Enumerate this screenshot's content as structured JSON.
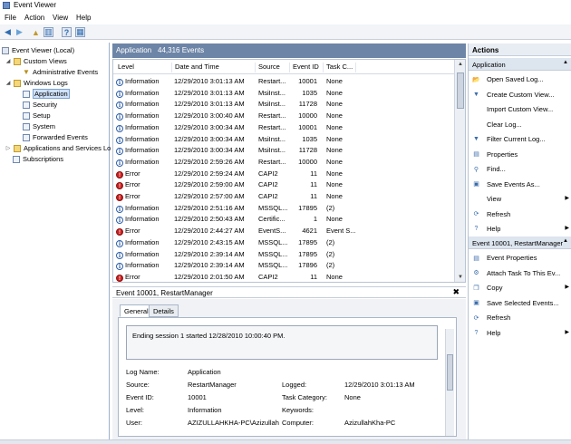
{
  "window": {
    "title": "Event Viewer"
  },
  "menu": [
    "File",
    "Action",
    "View",
    "Help"
  ],
  "toolbar": {
    "back_icon": "back-arrow-icon",
    "forward_icon": "forward-arrow-icon",
    "up_icon": "folder-up-icon",
    "tree_icon": "show-tree-icon",
    "help_icon": "help-icon",
    "pane_icon": "show-pane-icon"
  },
  "tree": {
    "root": "Event Viewer (Local)",
    "custom_views": "Custom Views",
    "admin_events": "Administrative Events",
    "windows_logs": "Windows Logs",
    "application": "Application",
    "security": "Security",
    "setup": "Setup",
    "system": "System",
    "forwarded": "Forwarded Events",
    "apps_services": "Applications and Services Lo",
    "subscriptions": "Subscriptions"
  },
  "center": {
    "log_name": "Application",
    "event_count": "44,316 Events"
  },
  "columns": [
    "Level",
    "Date and Time",
    "Source",
    "Event ID",
    "Task C..."
  ],
  "events": [
    {
      "level": "Information",
      "type": "info",
      "date": "12/29/2010 3:01:13 AM",
      "source": "Restart...",
      "id": "10001",
      "task": "None"
    },
    {
      "level": "Information",
      "type": "info",
      "date": "12/29/2010 3:01:13 AM",
      "source": "MsiInst...",
      "id": "1035",
      "task": "None"
    },
    {
      "level": "Information",
      "type": "info",
      "date": "12/29/2010 3:01:13 AM",
      "source": "MsiInst...",
      "id": "11728",
      "task": "None"
    },
    {
      "level": "Information",
      "type": "info",
      "date": "12/29/2010 3:00:40 AM",
      "source": "Restart...",
      "id": "10000",
      "task": "None"
    },
    {
      "level": "Information",
      "type": "info",
      "date": "12/29/2010 3:00:34 AM",
      "source": "Restart...",
      "id": "10001",
      "task": "None"
    },
    {
      "level": "Information",
      "type": "info",
      "date": "12/29/2010 3:00:34 AM",
      "source": "MsiInst...",
      "id": "1035",
      "task": "None"
    },
    {
      "level": "Information",
      "type": "info",
      "date": "12/29/2010 3:00:34 AM",
      "source": "MsiInst...",
      "id": "11728",
      "task": "None"
    },
    {
      "level": "Information",
      "type": "info",
      "date": "12/29/2010 2:59:26 AM",
      "source": "Restart...",
      "id": "10000",
      "task": "None"
    },
    {
      "level": "Error",
      "type": "err",
      "date": "12/29/2010 2:59:24 AM",
      "source": "CAPI2",
      "id": "11",
      "task": "None"
    },
    {
      "level": "Error",
      "type": "err",
      "date": "12/29/2010 2:59:00 AM",
      "source": "CAPI2",
      "id": "11",
      "task": "None"
    },
    {
      "level": "Error",
      "type": "err",
      "date": "12/29/2010 2:57:00 AM",
      "source": "CAPI2",
      "id": "11",
      "task": "None"
    },
    {
      "level": "Information",
      "type": "info",
      "date": "12/29/2010 2:51:16 AM",
      "source": "MSSQL...",
      "id": "17895",
      "task": "(2)"
    },
    {
      "level": "Information",
      "type": "info",
      "date": "12/29/2010 2:50:43 AM",
      "source": "Certific...",
      "id": "1",
      "task": "None"
    },
    {
      "level": "Error",
      "type": "err",
      "date": "12/29/2010 2:44:27 AM",
      "source": "EventS...",
      "id": "4621",
      "task": "Event S..."
    },
    {
      "level": "Information",
      "type": "info",
      "date": "12/29/2010 2:43:15 AM",
      "source": "MSSQL...",
      "id": "17895",
      "task": "(2)"
    },
    {
      "level": "Information",
      "type": "info",
      "date": "12/29/2010 2:39:14 AM",
      "source": "MSSQL...",
      "id": "17895",
      "task": "(2)"
    },
    {
      "level": "Information",
      "type": "info",
      "date": "12/29/2010 2:39:14 AM",
      "source": "MSSQL...",
      "id": "17896",
      "task": "(2)"
    },
    {
      "level": "Error",
      "type": "err",
      "date": "12/29/2010 2:01:50 AM",
      "source": "CAPI2",
      "id": "11",
      "task": "None"
    }
  ],
  "detail": {
    "title": "Event 10001, RestartManager",
    "close": "✖",
    "tabs": [
      "General",
      "Details"
    ],
    "message": "Ending session 1 started 12/28/2010 10:00:40 PM.",
    "fields": {
      "log_name_label": "Log Name:",
      "log_name": "Application",
      "source_label": "Source:",
      "source": "RestartManager",
      "logged_label": "Logged:",
      "logged": "12/29/2010 3:01:13 AM",
      "event_id_label": "Event ID:",
      "event_id": "10001",
      "task_label": "Task Category:",
      "task": "None",
      "level_label": "Level:",
      "level": "Information",
      "keywords_label": "Keywords:",
      "keywords": "",
      "user_label": "User:",
      "user": "AZIZULLAHKHA-PC\\Azizullah",
      "computer_label": "Computer:",
      "computer": "AzizullahKha-PC"
    }
  },
  "actions": {
    "title": "Actions",
    "section1": "Application",
    "items1": [
      {
        "label": "Open Saved Log...",
        "icon": "open-log-icon",
        "glyph": "📂",
        "sub": ""
      },
      {
        "label": "Create Custom View...",
        "icon": "filter-create-icon",
        "glyph": "▼",
        "sub": ""
      },
      {
        "label": "Import Custom View...",
        "icon": "",
        "glyph": "",
        "sub": ""
      },
      {
        "label": "Clear Log...",
        "icon": "",
        "glyph": "",
        "sub": ""
      },
      {
        "label": "Filter Current Log...",
        "icon": "filter-icon",
        "glyph": "▼",
        "sub": ""
      },
      {
        "label": "Properties",
        "icon": "properties-icon",
        "glyph": "▤",
        "sub": ""
      },
      {
        "label": "Find...",
        "icon": "find-icon",
        "glyph": "⚲",
        "sub": ""
      },
      {
        "label": "Save Events As...",
        "icon": "save-icon",
        "glyph": "▣",
        "sub": ""
      },
      {
        "label": "View",
        "icon": "",
        "glyph": "",
        "sub": "▶"
      },
      {
        "label": "Refresh",
        "icon": "refresh-icon",
        "glyph": "⟳",
        "sub": ""
      },
      {
        "label": "Help",
        "icon": "help-icon",
        "glyph": "?",
        "sub": "▶"
      }
    ],
    "section2": "Event 10001, RestartManager",
    "items2": [
      {
        "label": "Event Properties",
        "icon": "event-properties-icon",
        "glyph": "▤",
        "sub": ""
      },
      {
        "label": "Attach Task To This Ev...",
        "icon": "attach-task-icon",
        "glyph": "⚙",
        "sub": ""
      },
      {
        "label": "Copy",
        "icon": "copy-icon",
        "glyph": "❐",
        "sub": "▶"
      },
      {
        "label": "Save Selected Events...",
        "icon": "save-icon",
        "glyph": "▣",
        "sub": ""
      },
      {
        "label": "Refresh",
        "icon": "refresh-icon",
        "glyph": "⟳",
        "sub": ""
      },
      {
        "label": "Help",
        "icon": "help-icon",
        "glyph": "?",
        "sub": "▶"
      }
    ]
  },
  "colors": {
    "accent": "#6d85a6",
    "error": "#cc1f1f",
    "info": "#2d5fa8"
  }
}
